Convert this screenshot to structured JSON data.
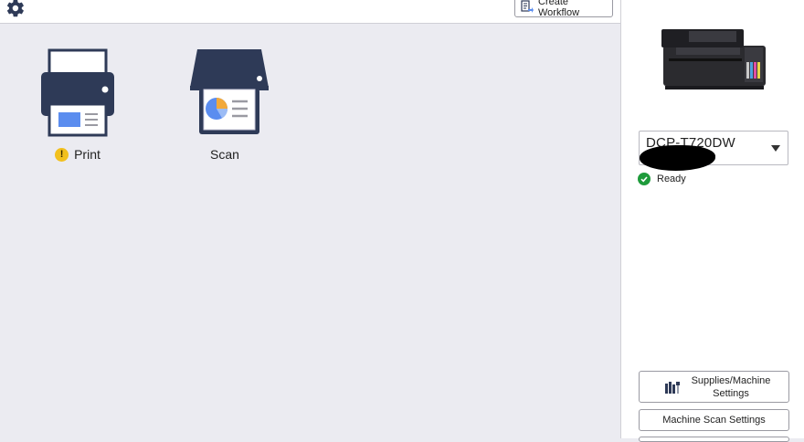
{
  "toolbar": {
    "settings_icon": "gear-icon",
    "create_workflow_label": "Create Workflow",
    "create_workflow_icon": "workflow-icon"
  },
  "tiles": [
    {
      "label": "Print",
      "icon": "printer-icon",
      "has_warning": true,
      "warning_symbol": "!"
    },
    {
      "label": "Scan",
      "icon": "scanner-icon",
      "has_warning": false
    }
  ],
  "device": {
    "image": "printer-device-image",
    "model": "DCP-T720DW",
    "status": "Ready",
    "status_color": "#1e9b3b"
  },
  "side_buttons": {
    "supplies_label": "Supplies/Machine Settings",
    "machine_scan_label": "Machine Scan Settings"
  },
  "colors": {
    "icon_navy": "#2e3a57",
    "accent_blue": "#5b8def",
    "warning_yellow": "#f2c01e"
  }
}
